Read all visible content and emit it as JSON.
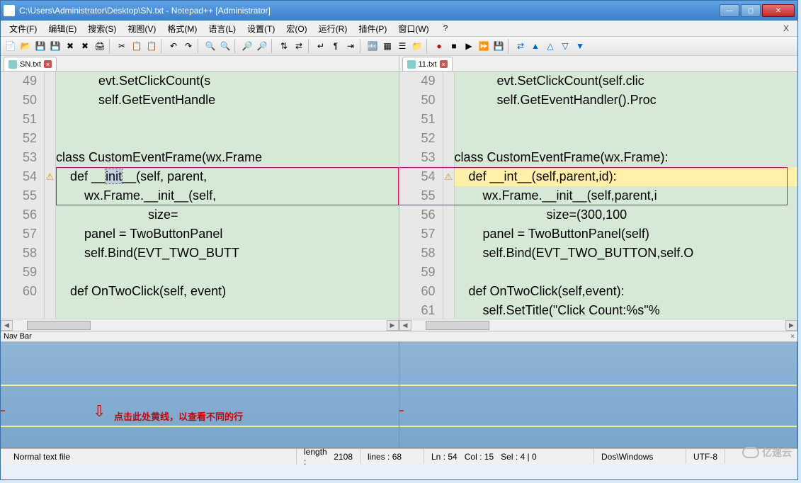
{
  "window": {
    "title": "C:\\Users\\Administrator\\Desktop\\SN.txt - Notepad++ [Administrator]"
  },
  "menu": {
    "file": "文件(F)",
    "edit": "编辑(E)",
    "search": "搜索(S)",
    "view": "视图(V)",
    "format": "格式(M)",
    "language": "语言(L)",
    "settings": "设置(T)",
    "macro": "宏(O)",
    "run": "运行(R)",
    "plugins": "插件(P)",
    "window": "窗口(W)",
    "help": "?"
  },
  "tabs": {
    "left": "SN.txt",
    "right": "11.txt"
  },
  "left_lines": {
    "start": 49,
    "code": [
      "            evt.SetClickCount(s",
      "            self.GetEventHandle",
      "",
      "",
      "class CustomEventFrame(wx.Frame",
      "    def __init__(self, parent,",
      "        wx.Frame.__init__(self,",
      "                          size=",
      "        panel = TwoButtonPanel",
      "        self.Bind(EVT_TWO_BUTT",
      "",
      "    def OnTwoClick(self, event)"
    ],
    "diff_line_index": 5,
    "selected_text": "init"
  },
  "right_lines": {
    "start": 49,
    "code": [
      "            evt.SetClickCount(self.clic",
      "            self.GetEventHandler().Proc",
      "",
      "",
      "class CustomEventFrame(wx.Frame):",
      "    def __int__(self,parent,id):",
      "        wx.Frame.__init__(self,parent,i",
      "                          size=(300,100",
      "        panel = TwoButtonPanel(self)",
      "        self.Bind(EVT_TWO_BUTTON,self.O",
      "",
      "    def OnTwoClick(self,event):",
      "        self.SetTitle(\"Click Count:%s\"%"
    ],
    "diff_line_index": 5
  },
  "navbar": {
    "label": "Nav Bar",
    "hint": "点击此处黄线，以查看不同的行"
  },
  "status": {
    "filetype": "Normal text file",
    "length_label": "length :",
    "length": "2108",
    "lines_label": "lines :",
    "lines": "68",
    "ln_label": "Ln :",
    "ln": "54",
    "col_label": "Col :",
    "col": "15",
    "sel_label": "Sel :",
    "sel": "4 | 0",
    "encoding": "Dos\\Windows",
    "charset": "UTF-8"
  },
  "watermark": "亿速云"
}
